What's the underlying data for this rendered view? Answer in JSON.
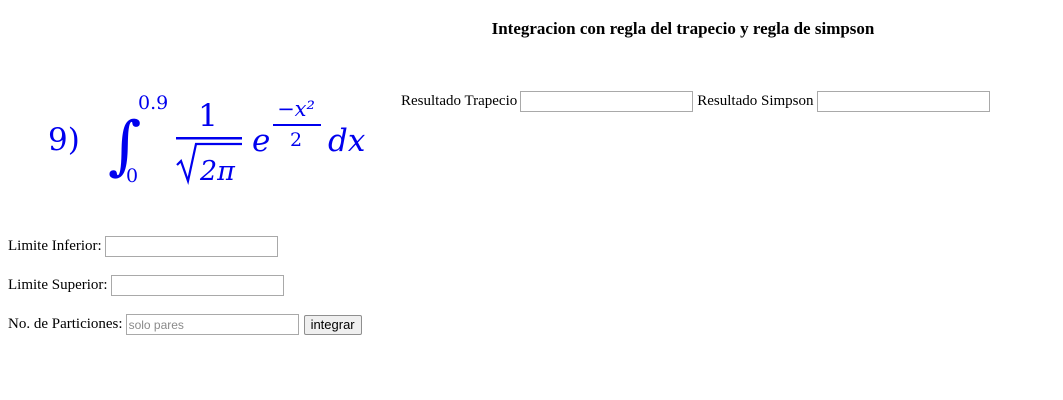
{
  "page": {
    "title": "Integracion con regla del trapecio y regla de simpson"
  },
  "results": {
    "trapecio_label": "Resultado Trapecio",
    "trapecio_value": "",
    "simpson_label": "Resultado Simpson",
    "simpson_value": ""
  },
  "formula": {
    "number": "9)",
    "upper_limit": "0.9",
    "lower_limit": "0",
    "numerator": "1",
    "denominator": "2π",
    "exponent_numerator": "−x²",
    "exponent_denominator": "2",
    "base": "e",
    "differential": "dx",
    "color": "#0000ee"
  },
  "form": {
    "lower_label": "Limite Inferior:",
    "lower_value": "",
    "upper_label": "Limite Superior:",
    "upper_value": "",
    "partitions_label": "No. de Particiones:",
    "partitions_placeholder": "solo pares",
    "partitions_value": "",
    "submit_label": "integrar"
  }
}
